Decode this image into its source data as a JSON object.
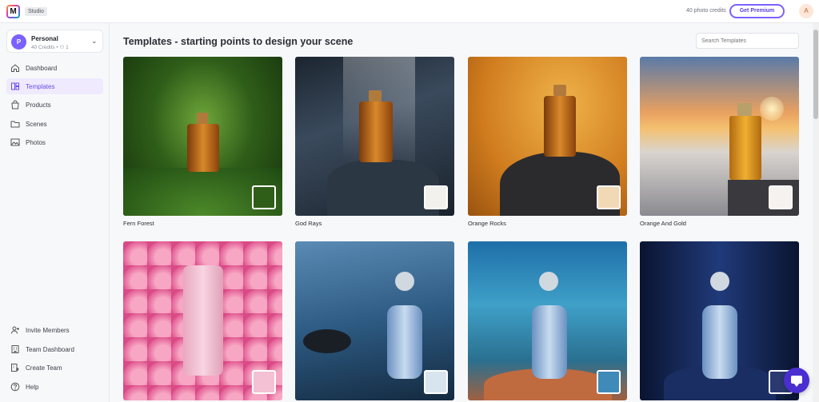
{
  "app": {
    "logo_letter": "M",
    "badge": "Studio"
  },
  "header": {
    "credits": "40 photo credits",
    "premium_label": "Get Premium",
    "user_initial": "A"
  },
  "workspace": {
    "initial": "P",
    "name": "Personal",
    "meta": "40 Credits • ⚇ 1"
  },
  "nav": [
    {
      "label": "Dashboard",
      "icon": "home-icon"
    },
    {
      "label": "Templates",
      "icon": "templates-icon",
      "active": true
    },
    {
      "label": "Products",
      "icon": "bag-icon"
    },
    {
      "label": "Scenes",
      "icon": "folder-icon"
    },
    {
      "label": "Photos",
      "icon": "image-icon"
    }
  ],
  "nav_bottom": [
    {
      "label": "Invite Members",
      "icon": "user-plus-icon"
    },
    {
      "label": "Team Dashboard",
      "icon": "building-icon"
    },
    {
      "label": "Create Team",
      "icon": "building-plus-icon"
    },
    {
      "label": "Help",
      "icon": "help-icon"
    }
  ],
  "main": {
    "title": "Templates - starting points to design your scene",
    "search_placeholder": "Search Templates"
  },
  "templates": [
    {
      "name": "Fern Forest"
    },
    {
      "name": "God Rays"
    },
    {
      "name": "Orange Rocks"
    },
    {
      "name": "Orange And Gold"
    },
    {
      "name": ""
    },
    {
      "name": ""
    },
    {
      "name": ""
    },
    {
      "name": ""
    }
  ],
  "colors": {
    "accent": "#7b61ff",
    "active_bg": "#efeafe",
    "chat": "#4a2ed0"
  }
}
